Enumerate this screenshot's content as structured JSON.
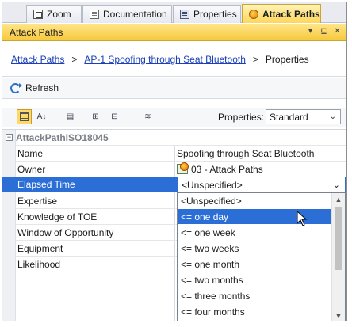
{
  "tabs": [
    {
      "label": "Zoom",
      "icon": "zoom-icon"
    },
    {
      "label": "Documentation",
      "icon": "document-icon"
    },
    {
      "label": "Properties",
      "icon": "properties-icon"
    },
    {
      "label": "Attack Paths",
      "icon": "attack-paths-icon",
      "active": true
    }
  ],
  "panel": {
    "title": "Attack Paths"
  },
  "breadcrumb": {
    "items": [
      "Attack Paths",
      "AP-1 Spoofing through Seat Bluetooth",
      "Properties"
    ],
    "separator": ">"
  },
  "toolbar": {
    "refresh_label": "Refresh"
  },
  "properties_toolbar": {
    "label": "Properties:",
    "selected": "Standard"
  },
  "grid": {
    "group": "AttackPathISO18045",
    "rows": [
      {
        "name": "Name",
        "value": "Spoofing through Seat Bluetooth"
      },
      {
        "name": "Owner",
        "value": "03 - Attack Paths"
      },
      {
        "name": "Elapsed Time",
        "value": "<Unspecified>"
      },
      {
        "name": "Expertise",
        "value": ""
      },
      {
        "name": "Knowledge of TOE",
        "value": ""
      },
      {
        "name": "Window of Opportunity",
        "value": ""
      },
      {
        "name": "Equipment",
        "value": ""
      },
      {
        "name": "Likelihood",
        "value": ""
      }
    ]
  },
  "dropdown": {
    "options": [
      "<Unspecified>",
      "<= one day",
      "<= one week",
      "<= two weeks",
      "<= one month",
      "<= two months",
      "<= three months",
      "<= four months"
    ],
    "highlighted": "<= one day"
  },
  "colors": {
    "accent": "#2a6ed6",
    "tab_active": "#ffd65a",
    "link": "#1a3fb8"
  }
}
